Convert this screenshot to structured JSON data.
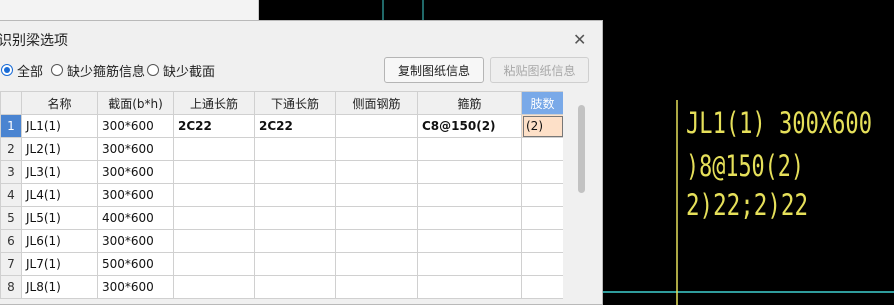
{
  "cad": {
    "colors": {
      "line": "#3fd0d0",
      "text": "#e6e05a",
      "bg": "#000000"
    },
    "lines": [
      "JL1(1) 300X600",
      ")8@150(2)",
      "2)22;2)22"
    ]
  },
  "dialog": {
    "title": "识别梁选项",
    "filters": [
      "全部",
      "缺少箍筋信息",
      "缺少截面"
    ],
    "selected_filter": "全部",
    "copy_button": "复制图纸信息",
    "paste_button": "粘贴图纸信息"
  },
  "table": {
    "columns": [
      "",
      "名称",
      "截面(b*h)",
      "上通长筋",
      "下通长筋",
      "侧面钢筋",
      "箍筋",
      "肢数"
    ],
    "rows": [
      [
        "1",
        "JL1(1)",
        "300*600",
        "2C22",
        "2C22",
        "",
        "C8@150(2)",
        "(2)"
      ],
      [
        "2",
        "JL2(1)",
        "300*600",
        "",
        "",
        "",
        "",
        ""
      ],
      [
        "3",
        "JL3(1)",
        "300*600",
        "",
        "",
        "",
        "",
        ""
      ],
      [
        "4",
        "JL4(1)",
        "300*600",
        "",
        "",
        "",
        "",
        ""
      ],
      [
        "5",
        "JL5(1)",
        "400*600",
        "",
        "",
        "",
        "",
        ""
      ],
      [
        "6",
        "JL6(1)",
        "300*600",
        "",
        "",
        "",
        "",
        ""
      ],
      [
        "7",
        "JL7(1)",
        "500*600",
        "",
        "",
        "",
        "",
        ""
      ],
      [
        "8",
        "JL8(1)",
        "300*600",
        "",
        "",
        "",
        "",
        ""
      ]
    ]
  }
}
